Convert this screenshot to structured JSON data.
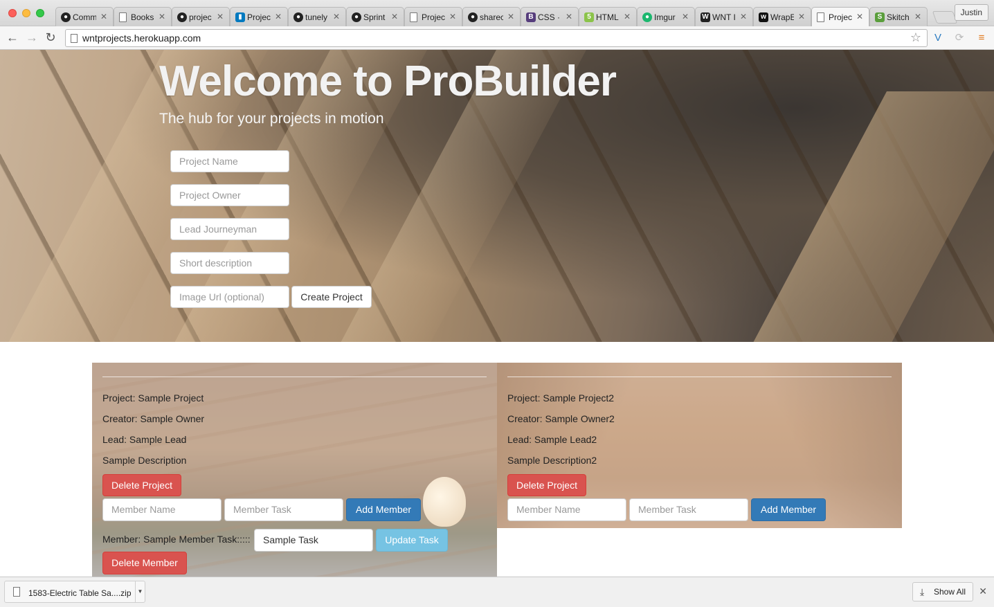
{
  "browser": {
    "tabs": [
      {
        "label": "Comm",
        "icon": "github-icon"
      },
      {
        "label": "Books",
        "icon": "document-icon"
      },
      {
        "label": "projec",
        "icon": "github-icon"
      },
      {
        "label": "Projec",
        "icon": "trello-icon"
      },
      {
        "label": "tunely",
        "icon": "github-icon"
      },
      {
        "label": "Sprint",
        "icon": "github-icon"
      },
      {
        "label": "Projec",
        "icon": "document-icon"
      },
      {
        "label": "sharec",
        "icon": "github-icon"
      },
      {
        "label": "CSS ·",
        "icon": "bootstrap-icon"
      },
      {
        "label": "HTML",
        "icon": "html-icon"
      },
      {
        "label": "Imgur",
        "icon": "imgur-icon"
      },
      {
        "label": "WNT I",
        "icon": "wnt-icon"
      },
      {
        "label": "WrapE",
        "icon": "wrapbootstrap-icon"
      },
      {
        "label": "Projec",
        "icon": "document-icon",
        "active": true
      },
      {
        "label": "Skitch",
        "icon": "skitch-icon"
      }
    ],
    "profile": "Justin",
    "url": "wntprojects.herokuapp.com"
  },
  "hero": {
    "title": "Welcome to ProBuilder",
    "subtitle": "The hub for your projects in motion",
    "form": {
      "project_name_placeholder": "Project Name",
      "project_owner_placeholder": "Project Owner",
      "lead_placeholder": "Lead Journeyman",
      "description_placeholder": "Short description",
      "image_url_placeholder": "Image Url (optional)",
      "create_label": "Create Project"
    }
  },
  "projects": [
    {
      "project": "Project: Sample Project",
      "creator": "Creator: Sample Owner",
      "lead": "Lead: Sample Lead",
      "description": "Sample Description",
      "delete_label": "Delete Project",
      "member_name_placeholder": "Member Name",
      "member_task_placeholder": "Member Task",
      "add_member_label": "Add Member",
      "members": [
        {
          "text": "Member: Sample Member Task:::::",
          "task_value": "Sample Task",
          "update_label": "Update Task",
          "delete_label": "Delete Member"
        }
      ]
    },
    {
      "project": "Project: Sample Project2",
      "creator": "Creator: Sample Owner2",
      "lead": "Lead: Sample Lead2",
      "description": "Sample Description2",
      "delete_label": "Delete Project",
      "member_name_placeholder": "Member Name",
      "member_task_placeholder": "Member Task",
      "add_member_label": "Add Member",
      "members": []
    }
  ],
  "downloads": {
    "file": "1583-Electric Table Sa....zip",
    "show_all": "Show All"
  },
  "colors": {
    "danger": "#d9534f",
    "primary": "#337ab7",
    "info": "#76c3e3"
  }
}
